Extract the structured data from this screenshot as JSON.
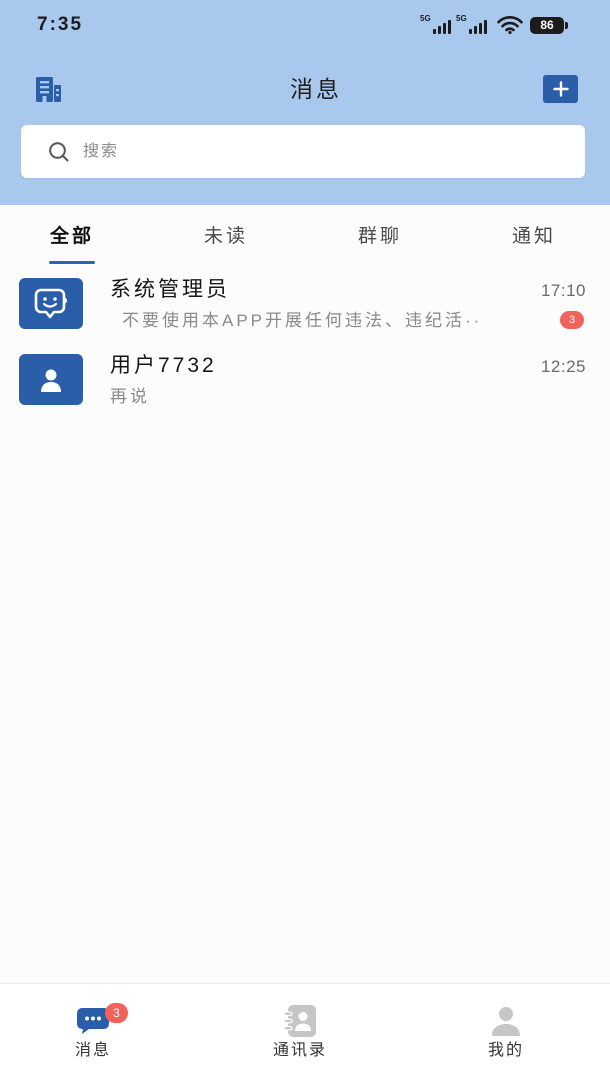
{
  "status_bar": {
    "time": "7:35",
    "signal_1_label": "5G",
    "signal_2_label": "5G",
    "battery_level": "86",
    "icons": [
      "signal-icon",
      "signal-icon",
      "wifi-icon",
      "battery-icon"
    ]
  },
  "header": {
    "title": "消息",
    "left_icon": "building-icon",
    "right_icon": "plus-icon"
  },
  "search": {
    "placeholder": "搜索",
    "icon": "search-icon"
  },
  "tabs": [
    {
      "label": "全部",
      "active": true
    },
    {
      "label": "未读",
      "active": false
    },
    {
      "label": "群聊",
      "active": false
    },
    {
      "label": "通知",
      "active": false
    }
  ],
  "conversations": [
    {
      "name": "系统管理员",
      "time": "17:10",
      "preview": "不要使用本APP开展任何违法、违纪活··",
      "unread_count": "3",
      "avatar_icon": "bot-chat-icon"
    },
    {
      "name": "用户7732",
      "time": "12:25",
      "preview": "再说",
      "avatar_icon": "person-icon"
    }
  ],
  "bottom_nav": [
    {
      "label": "消息",
      "icon": "chat-bubble-icon",
      "badge": "3",
      "active": true
    },
    {
      "label": "通讯录",
      "icon": "contacts-icon",
      "active": false
    },
    {
      "label": "我的",
      "icon": "profile-icon",
      "active": false
    }
  ],
  "colors": {
    "header_bg": "#a9c8ee",
    "accent": "#2b5ea8",
    "tab_indicator": "#2a64b8",
    "badge": "#f0625a",
    "inactive_icon": "#c6c6c6"
  }
}
